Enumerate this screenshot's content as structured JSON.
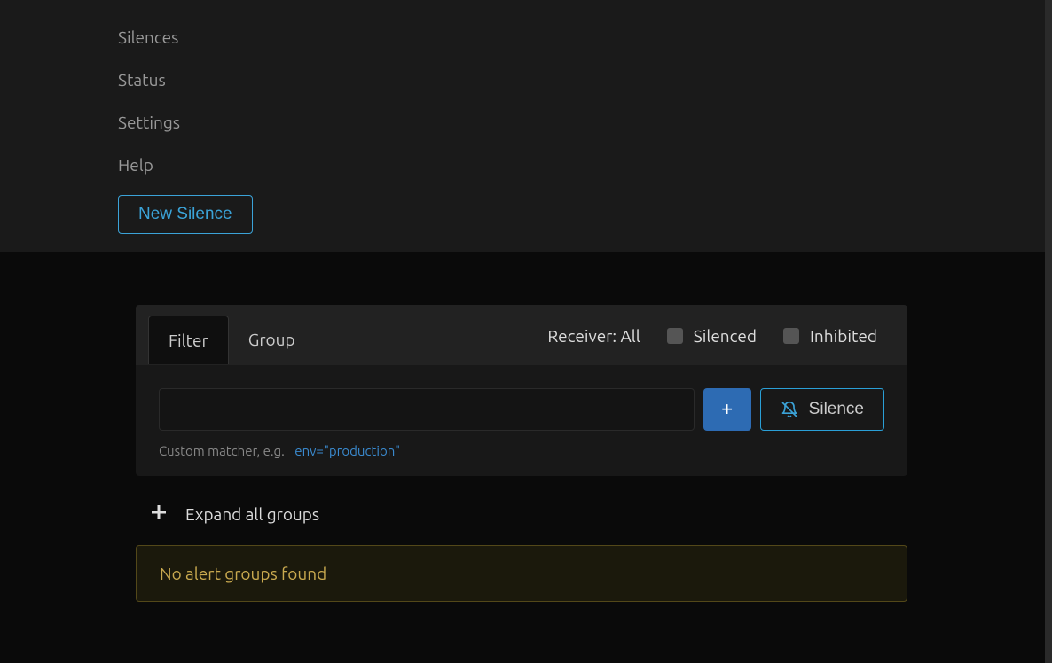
{
  "nav": {
    "items": [
      "Silences",
      "Status",
      "Settings",
      "Help"
    ],
    "new_silence": "New Silence"
  },
  "tabs": {
    "filter": "Filter",
    "group": "Group"
  },
  "controls": {
    "receiver_label": "Receiver: All",
    "silenced": "Silenced",
    "inhibited": "Inhibited"
  },
  "filter": {
    "input_value": "",
    "add_btn": "+",
    "silence_btn": "Silence",
    "hint_prefix": "Custom matcher, e.g.",
    "hint_example": "env=\"production\""
  },
  "expand": {
    "label": "Expand all groups"
  },
  "alert": {
    "message": "No alert groups found"
  }
}
